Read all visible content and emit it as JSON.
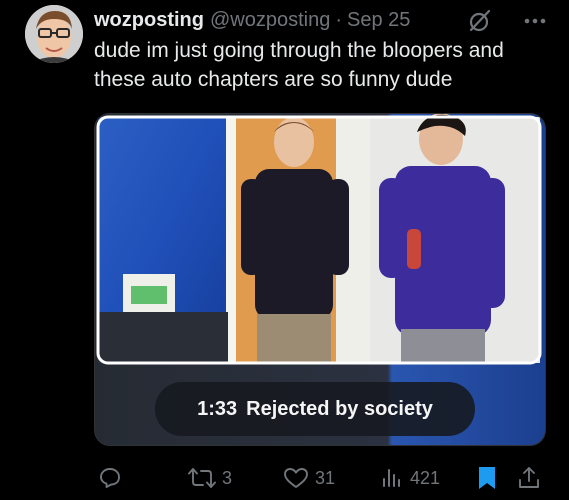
{
  "author": {
    "display_name": "wozposting",
    "handle": "@wozposting",
    "separator": "·",
    "date": "Sep 25"
  },
  "post": {
    "lines": [
      "dude im just going through the bloopers and",
      "these auto chapters are so funny dude"
    ]
  },
  "media": {
    "chapter_time": "1:33",
    "chapter_title": "Rejected by society"
  },
  "actions": {
    "reply_count": "",
    "retweet_count": "3",
    "like_count": "31",
    "views_count": "421"
  },
  "icons": {
    "header": [
      "grok-icon",
      "more-icon"
    ],
    "actions": [
      "reply-icon",
      "retweet-icon",
      "like-icon",
      "views-icon",
      "bookmark-icon",
      "share-icon"
    ]
  },
  "colors": {
    "background": "#000000",
    "primary_text": "#e7e9ea",
    "secondary_text": "#71767b",
    "bookmark_accent": "#1d9bf0"
  }
}
